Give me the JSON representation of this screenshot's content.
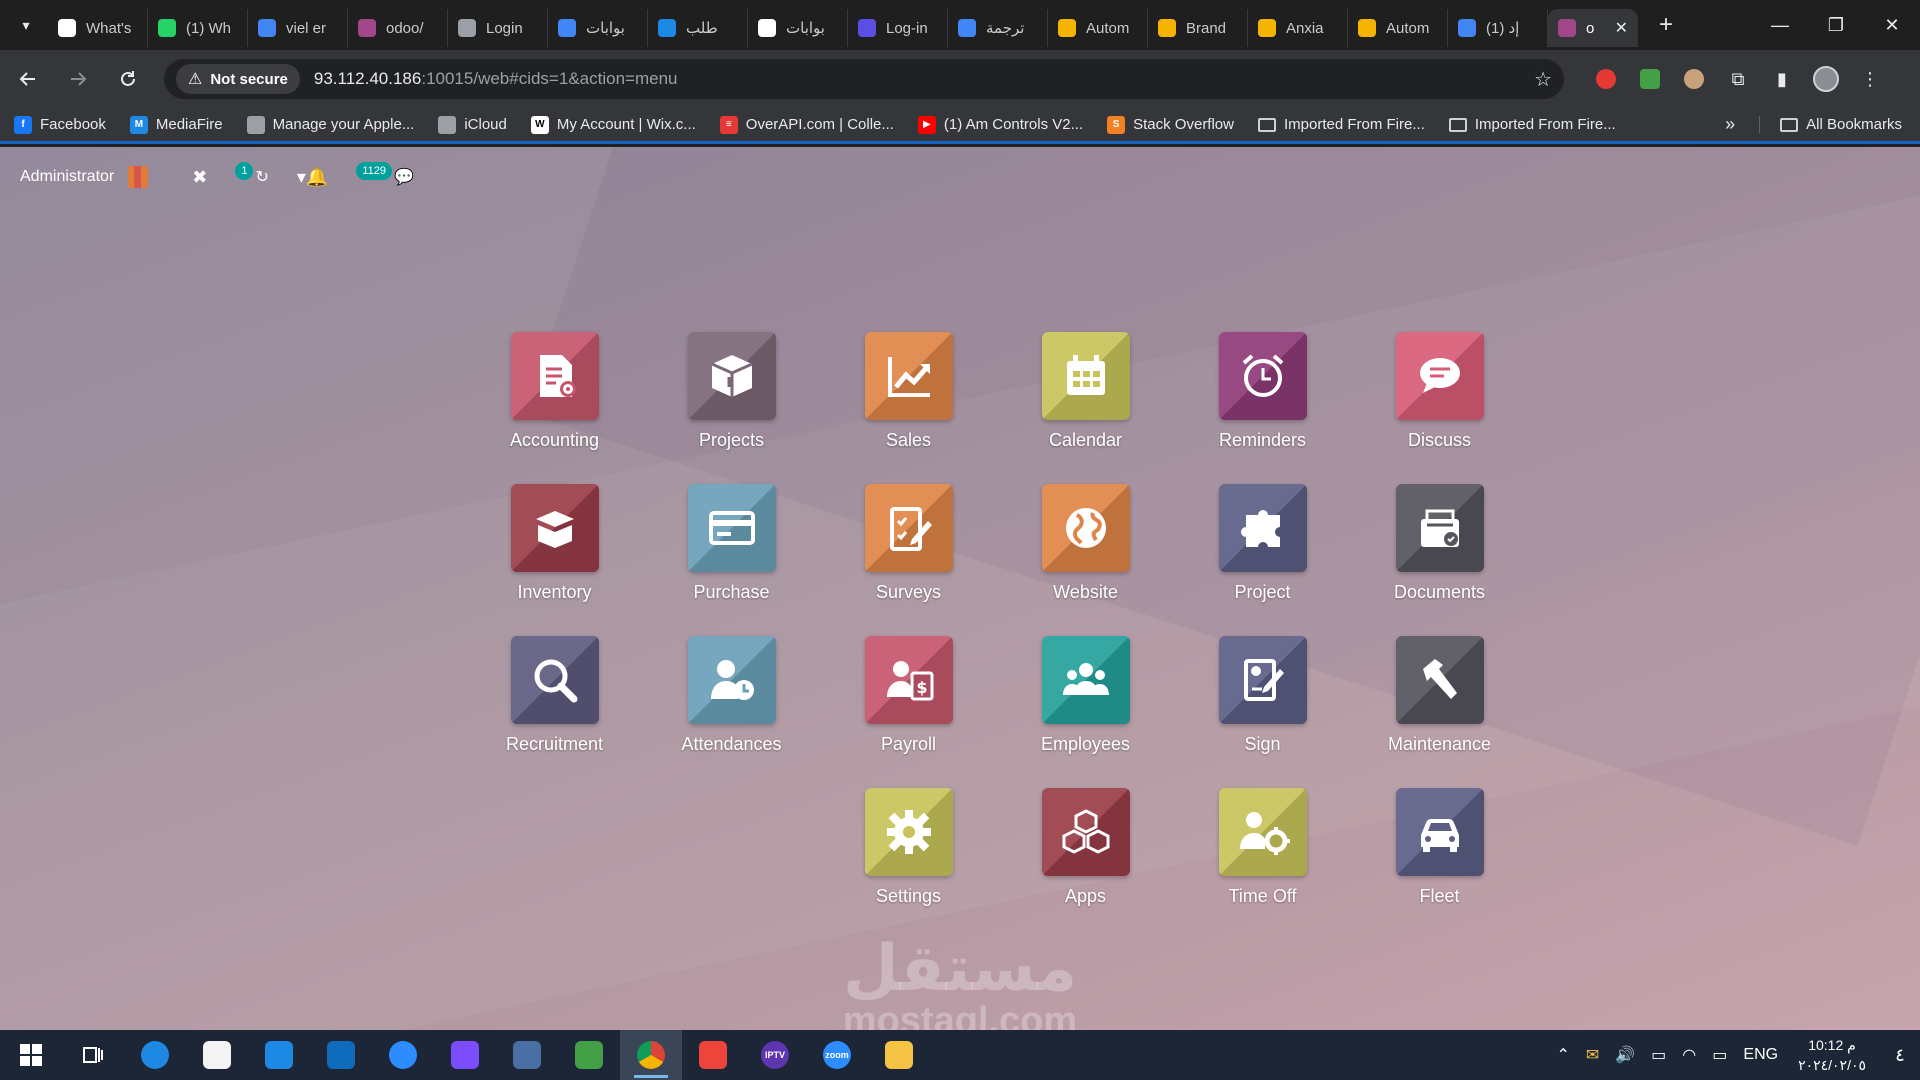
{
  "tabs": [
    {
      "title": "What's",
      "fav": "#ffffff",
      "fav_fg": "#1f1f1f",
      "icon": "chrome-icon"
    },
    {
      "title": "(1) Wh",
      "fav": "#25d366",
      "icon": "whatsapp-icon"
    },
    {
      "title": "viel er",
      "fav": "#4285f4",
      "icon": "google-icon"
    },
    {
      "title": "odoo/",
      "fav": "#a24689",
      "icon": "odoo-icon"
    },
    {
      "title": "Login",
      "fav": "#9aa0a6",
      "icon": "generic-icon"
    },
    {
      "title": "بوابات",
      "fav": "#4285f4",
      "icon": "google-icon"
    },
    {
      "title": "طلب",
      "fav": "#1e88e5",
      "icon": "chart-icon"
    },
    {
      "title": "بوابات",
      "fav": "#ffffff",
      "fav_fg": "#c62828",
      "icon": "doc-icon"
    },
    {
      "title": "Log-in",
      "fav": "#5c4ee5",
      "icon": "h-icon"
    },
    {
      "title": "ترجمة",
      "fav": "#4285f4",
      "icon": "translate-icon"
    },
    {
      "title": "Autom",
      "fav": "#f4b400",
      "icon": "lightning-icon"
    },
    {
      "title": "Brand",
      "fav": "#f4b400",
      "icon": "lightning-icon"
    },
    {
      "title": "Anxia",
      "fav": "#f4b400",
      "icon": "lightning-icon"
    },
    {
      "title": "Autom",
      "fav": "#f4b400",
      "icon": "lightning-icon"
    },
    {
      "title": "(1) إد",
      "fav": "#4285f4",
      "icon": "google-icon"
    },
    {
      "title": "o",
      "fav": "#a24689",
      "icon": "odoo-icon",
      "active": true
    }
  ],
  "window_controls": {
    "minimize": "—",
    "restore": "❐",
    "close": "✕"
  },
  "address": {
    "not_secure": "Not secure",
    "host": "93.112.40.186",
    "path": ":10015/web#cids=1&action=menu"
  },
  "bookmarks": [
    {
      "label": "Facebook",
      "color": "#1877f2",
      "glyph": "f"
    },
    {
      "label": "MediaFire",
      "color": "#1e88e5",
      "glyph": "M"
    },
    {
      "label": "Manage your Apple...",
      "color": "#9aa0a6",
      "glyph": ""
    },
    {
      "label": "iCloud",
      "color": "#9aa0a6",
      "glyph": ""
    },
    {
      "label": "My Account | Wix.c...",
      "color": "#ffffff",
      "glyph": "W",
      "fg": "#000000"
    },
    {
      "label": "OverAPI.com | Colle...",
      "color": "#e53935",
      "glyph": "≡"
    },
    {
      "label": "(1) Am Controls V2...",
      "color": "#ff0000",
      "glyph": "▶"
    },
    {
      "label": "Stack Overflow",
      "color": "#f48024",
      "glyph": "S"
    },
    {
      "label": "Imported From Fire...",
      "folder": true
    },
    {
      "label": "Imported From Fire...",
      "folder": true
    }
  ],
  "bookmarks_more": "»",
  "all_bookmarks": "All Bookmarks",
  "systray": {
    "user": "Administrator",
    "activity_badge": "1",
    "messages_badge": "1129"
  },
  "apps": [
    {
      "label": "Accounting",
      "color": "#c5566c",
      "icon": "accounting"
    },
    {
      "label": "Projects",
      "color": "#7d6877",
      "icon": "box"
    },
    {
      "label": "Sales",
      "color": "#e08547",
      "icon": "sales"
    },
    {
      "label": "Calendar",
      "color": "#c8c35b",
      "icon": "calendar"
    },
    {
      "label": "Reminders",
      "color": "#8e3b78",
      "icon": "alarm"
    },
    {
      "label": "Discuss",
      "color": "#d85c77",
      "icon": "chat"
    },
    {
      "label": "Inventory",
      "color": "#9a3d48",
      "icon": "inventory"
    },
    {
      "label": "Purchase",
      "color": "#6aa0b8",
      "icon": "card"
    },
    {
      "label": "Surveys",
      "color": "#e08547",
      "icon": "survey"
    },
    {
      "label": "Website",
      "color": "#e08547",
      "icon": "globe"
    },
    {
      "label": "Project",
      "color": "#5c5e86",
      "icon": "puzzle"
    },
    {
      "label": "Documents",
      "color": "#55545d",
      "icon": "documents"
    },
    {
      "label": "Recruitment",
      "color": "#5e5b7f",
      "icon": "search"
    },
    {
      "label": "Attendances",
      "color": "#6aa0b8",
      "icon": "attendance"
    },
    {
      "label": "Payroll",
      "color": "#c5566c",
      "icon": "payroll"
    },
    {
      "label": "Employees",
      "color": "#24a19c",
      "icon": "team"
    },
    {
      "label": "Sign",
      "color": "#5c5e86",
      "icon": "sign"
    },
    {
      "label": "Maintenance",
      "color": "#55545d",
      "icon": "hammer"
    },
    {
      "label": "Settings",
      "color": "#c8c35b",
      "icon": "gear"
    },
    {
      "label": "Apps",
      "color": "#9a3d48",
      "icon": "cubes"
    },
    {
      "label": "Time Off",
      "color": "#c8c35b",
      "icon": "timeoff"
    },
    {
      "label": "Fleet",
      "color": "#5c5e86",
      "icon": "car"
    }
  ],
  "watermark": {
    "arabic": "مستقل",
    "latin": "mostaql.com"
  },
  "taskbar": {
    "apps": [
      {
        "name": "start",
        "color": "transparent"
      },
      {
        "name": "task-view",
        "color": "transparent"
      },
      {
        "name": "edge",
        "color": "#1e88e5"
      },
      {
        "name": "store",
        "color": "#f4f4f4"
      },
      {
        "name": "mail",
        "color": "#1e88e5"
      },
      {
        "name": "outlook",
        "color": "#0f6cbd"
      },
      {
        "name": "zoom-meetings",
        "color": "#2d8cff"
      },
      {
        "name": "visual-studio",
        "color": "#7c4dff"
      },
      {
        "name": "network-app",
        "color": "#4a6fa5"
      },
      {
        "name": "photos",
        "color": "#43a047"
      },
      {
        "name": "chrome",
        "color": "#db4437",
        "active": true
      },
      {
        "name": "anydesk",
        "color": "#ef443b"
      },
      {
        "name": "iptv",
        "color": "#5e35b1",
        "label": "IPTV"
      },
      {
        "name": "zoom",
        "color": "#2d8cff",
        "label": "zoom"
      },
      {
        "name": "file-explorer",
        "color": "#f6c445"
      }
    ],
    "language": "ENG",
    "time": "10:12 م",
    "date": "٢٠٢٤/٠٢/٠٥",
    "notifications": "٤"
  }
}
